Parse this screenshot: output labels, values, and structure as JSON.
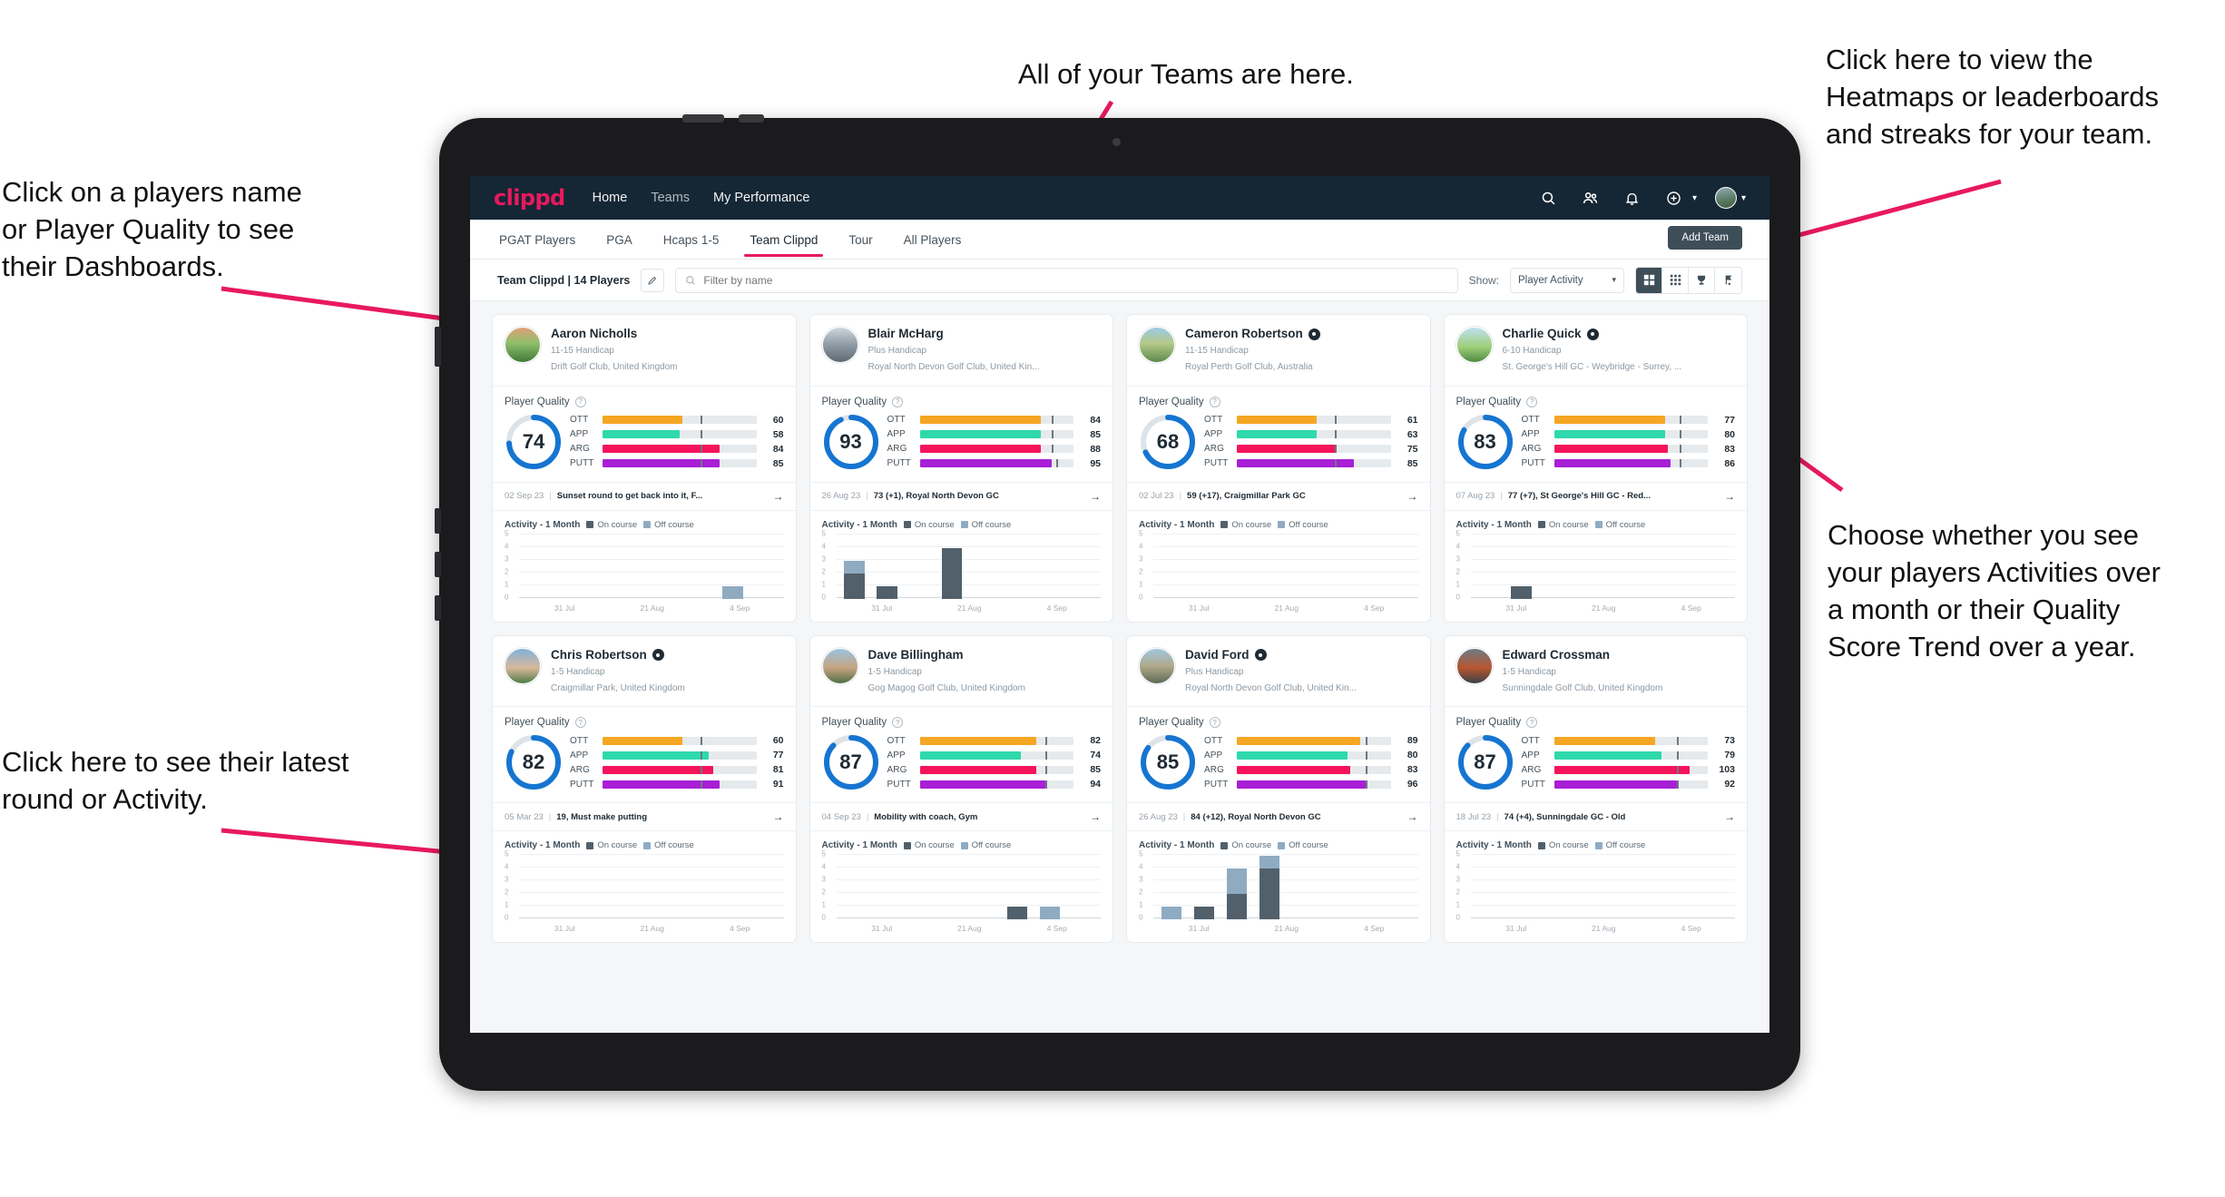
{
  "annotations": {
    "left_top": "Click on a players name\nor Player Quality to see\ntheir Dashboards.",
    "center_top": "All of your Teams are here.",
    "right_top": "Click here to view the\nHeatmaps or leaderboards\nand streaks for your team.",
    "right_mid": "Choose whether you see\nyour players Activities over\na month or their Quality\nScore Trend over a year.",
    "left_bottom": "Click here to see their latest\nround or Activity."
  },
  "accent_color": "#e8195e",
  "appbar": {
    "brand": "clippd",
    "links": [
      {
        "label": "Home",
        "active": true
      },
      {
        "label": "Teams",
        "active": false
      },
      {
        "label": "My Performance",
        "active": true
      }
    ],
    "icons": [
      "search-icon",
      "people-icon",
      "bell-icon",
      "plus-circle-icon",
      "avatar"
    ]
  },
  "tabs": [
    {
      "label": "PGAT Players",
      "active": false
    },
    {
      "label": "PGA",
      "active": false
    },
    {
      "label": "Hcaps 1-5",
      "active": false
    },
    {
      "label": "Team Clippd",
      "active": true
    },
    {
      "label": "Tour",
      "active": false
    },
    {
      "label": "All Players",
      "active": false
    }
  ],
  "add_team_label": "Add Team",
  "filterbar": {
    "team_label": "Team Clippd | 14 Players",
    "edit_icon": "pencil-icon",
    "search_placeholder": "Filter by name",
    "search_value": "",
    "show_label": "Show:",
    "show_value": "Player Activity",
    "view_toggles": [
      {
        "name": "grid-large-icon",
        "active": true
      },
      {
        "name": "grid-small-icon",
        "active": false
      },
      {
        "name": "trophy-icon",
        "active": false
      },
      {
        "name": "flag-icon",
        "active": false
      }
    ]
  },
  "metric_colors": {
    "OTT": "#f5a623",
    "APP": "#2ed9ac",
    "ARG": "#f5145b",
    "PUTT": "#a81fd6"
  },
  "activity_legend": {
    "on": "On course",
    "off": "Off course"
  },
  "activity_title": "Activity - 1 Month",
  "chart_axis": {
    "yticks": [
      5,
      4,
      3,
      2,
      1,
      0
    ],
    "xticks": [
      "31 Jul",
      "21 Aug",
      "4 Sep"
    ]
  },
  "players": [
    {
      "name": "Aaron Nicholls",
      "verified": false,
      "handicap": "11-15 Handicap",
      "club": "Drift Golf Club, United Kingdom",
      "quality_label": "Player Quality",
      "score": 74,
      "metrics": [
        {
          "key": "OTT",
          "value": 60,
          "fill": 52,
          "tick": 64
        },
        {
          "key": "APP",
          "value": 58,
          "fill": 50,
          "tick": 64
        },
        {
          "key": "ARG",
          "value": 84,
          "fill": 76,
          "tick": 64
        },
        {
          "key": "PUTT",
          "value": 85,
          "fill": 76,
          "tick": 64
        }
      ],
      "round": {
        "date": "02 Sep 23",
        "text": "Sunset round to get back into it, F..."
      },
      "chart_data": {
        "type": "bar",
        "bars": [
          {
            "on": 0,
            "off": 0
          },
          {
            "on": 0,
            "off": 0
          },
          {
            "on": 0,
            "off": 0
          },
          {
            "on": 0,
            "off": 0
          },
          {
            "on": 0,
            "off": 0
          },
          {
            "on": 0,
            "off": 0
          },
          {
            "on": 0,
            "off": 1
          },
          {
            "on": 0,
            "off": 0
          }
        ]
      }
    },
    {
      "name": "Blair McHarg",
      "verified": false,
      "handicap": "Plus Handicap",
      "club": "Royal North Devon Golf Club, United Kin...",
      "quality_label": "Player Quality",
      "score": 93,
      "metrics": [
        {
          "key": "OTT",
          "value": 84,
          "fill": 79,
          "tick": 86
        },
        {
          "key": "APP",
          "value": 85,
          "fill": 79,
          "tick": 86
        },
        {
          "key": "ARG",
          "value": 88,
          "fill": 79,
          "tick": 86
        },
        {
          "key": "PUTT",
          "value": 95,
          "fill": 86,
          "tick": 89
        }
      ],
      "round": {
        "date": "26 Aug 23",
        "text": "73 (+1), Royal North Devon GC"
      },
      "chart_data": {
        "type": "bar",
        "bars": [
          {
            "on": 2,
            "off": 1
          },
          {
            "on": 1,
            "off": 0
          },
          {
            "on": 0,
            "off": 0
          },
          {
            "on": 4,
            "off": 0
          },
          {
            "on": 0,
            "off": 0
          },
          {
            "on": 0,
            "off": 0
          },
          {
            "on": 0,
            "off": 0
          },
          {
            "on": 0,
            "off": 0
          }
        ]
      }
    },
    {
      "name": "Cameron Robertson",
      "verified": true,
      "handicap": "11-15 Handicap",
      "club": "Royal Perth Golf Club, Australia",
      "quality_label": "Player Quality",
      "score": 68,
      "metrics": [
        {
          "key": "OTT",
          "value": 61,
          "fill": 52,
          "tick": 64
        },
        {
          "key": "APP",
          "value": 63,
          "fill": 52,
          "tick": 64
        },
        {
          "key": "ARG",
          "value": 75,
          "fill": 65,
          "tick": 64
        },
        {
          "key": "PUTT",
          "value": 85,
          "fill": 76,
          "tick": 64
        }
      ],
      "round": {
        "date": "02 Jul 23",
        "text": "59 (+17), Craigmillar Park GC"
      },
      "chart_data": {
        "type": "bar",
        "bars": [
          {
            "on": 0,
            "off": 0
          },
          {
            "on": 0,
            "off": 0
          },
          {
            "on": 0,
            "off": 0
          },
          {
            "on": 0,
            "off": 0
          },
          {
            "on": 0,
            "off": 0
          },
          {
            "on": 0,
            "off": 0
          },
          {
            "on": 0,
            "off": 0
          },
          {
            "on": 0,
            "off": 0
          }
        ]
      }
    },
    {
      "name": "Charlie Quick",
      "verified": true,
      "handicap": "6-10 Handicap",
      "club": "St. George's Hill GC - Weybridge - Surrey, ...",
      "quality_label": "Player Quality",
      "score": 83,
      "metrics": [
        {
          "key": "OTT",
          "value": 77,
          "fill": 72,
          "tick": 82
        },
        {
          "key": "APP",
          "value": 80,
          "fill": 72,
          "tick": 82
        },
        {
          "key": "ARG",
          "value": 83,
          "fill": 74,
          "tick": 82
        },
        {
          "key": "PUTT",
          "value": 86,
          "fill": 76,
          "tick": 82
        }
      ],
      "round": {
        "date": "07 Aug 23",
        "text": "77 (+7), St George's Hill GC - Red..."
      },
      "chart_data": {
        "type": "bar",
        "bars": [
          {
            "on": 0,
            "off": 0
          },
          {
            "on": 1,
            "off": 0
          },
          {
            "on": 0,
            "off": 0
          },
          {
            "on": 0,
            "off": 0
          },
          {
            "on": 0,
            "off": 0
          },
          {
            "on": 0,
            "off": 0
          },
          {
            "on": 0,
            "off": 0
          },
          {
            "on": 0,
            "off": 0
          }
        ]
      }
    },
    {
      "name": "Chris Robertson",
      "verified": true,
      "handicap": "1-5 Handicap",
      "club": "Craigmillar Park, United Kingdom",
      "quality_label": "Player Quality",
      "score": 82,
      "metrics": [
        {
          "key": "OTT",
          "value": 60,
          "fill": 52,
          "tick": 64
        },
        {
          "key": "APP",
          "value": 77,
          "fill": 69,
          "tick": 64
        },
        {
          "key": "ARG",
          "value": 81,
          "fill": 72,
          "tick": 64
        },
        {
          "key": "PUTT",
          "value": 91,
          "fill": 76,
          "tick": 64
        }
      ],
      "round": {
        "date": "05 Mar 23",
        "text": "19, Must make putting"
      },
      "chart_data": {
        "type": "bar",
        "bars": [
          {
            "on": 0,
            "off": 0
          },
          {
            "on": 0,
            "off": 0
          },
          {
            "on": 0,
            "off": 0
          },
          {
            "on": 0,
            "off": 0
          },
          {
            "on": 0,
            "off": 0
          },
          {
            "on": 0,
            "off": 0
          },
          {
            "on": 0,
            "off": 0
          },
          {
            "on": 0,
            "off": 0
          }
        ]
      }
    },
    {
      "name": "Dave Billingham",
      "verified": false,
      "handicap": "1-5 Handicap",
      "club": "Gog Magog Golf Club, United Kingdom",
      "quality_label": "Player Quality",
      "score": 87,
      "metrics": [
        {
          "key": "OTT",
          "value": 82,
          "fill": 76,
          "tick": 82
        },
        {
          "key": "APP",
          "value": 74,
          "fill": 66,
          "tick": 82
        },
        {
          "key": "ARG",
          "value": 85,
          "fill": 76,
          "tick": 82
        },
        {
          "key": "PUTT",
          "value": 94,
          "fill": 82,
          "tick": 82
        }
      ],
      "round": {
        "date": "04 Sep 23",
        "text": "Mobility with coach, Gym"
      },
      "chart_data": {
        "type": "bar",
        "bars": [
          {
            "on": 0,
            "off": 0
          },
          {
            "on": 0,
            "off": 0
          },
          {
            "on": 0,
            "off": 0
          },
          {
            "on": 0,
            "off": 0
          },
          {
            "on": 0,
            "off": 0
          },
          {
            "on": 1,
            "off": 0
          },
          {
            "on": 0,
            "off": 1
          },
          {
            "on": 0,
            "off": 0
          }
        ]
      }
    },
    {
      "name": "David Ford",
      "verified": true,
      "handicap": "Plus Handicap",
      "club": "Royal North Devon Golf Club, United Kin...",
      "quality_label": "Player Quality",
      "score": 85,
      "metrics": [
        {
          "key": "OTT",
          "value": 89,
          "fill": 80,
          "tick": 84
        },
        {
          "key": "APP",
          "value": 80,
          "fill": 72,
          "tick": 84
        },
        {
          "key": "ARG",
          "value": 83,
          "fill": 74,
          "tick": 84
        },
        {
          "key": "PUTT",
          "value": 96,
          "fill": 84,
          "tick": 84
        }
      ],
      "round": {
        "date": "26 Aug 23",
        "text": "84 (+12), Royal North Devon GC"
      },
      "chart_data": {
        "type": "bar",
        "bars": [
          {
            "on": 0,
            "off": 1
          },
          {
            "on": 1,
            "off": 0
          },
          {
            "on": 2,
            "off": 2
          },
          {
            "on": 4,
            "off": 1
          },
          {
            "on": 0,
            "off": 0
          },
          {
            "on": 0,
            "off": 0
          },
          {
            "on": 0,
            "off": 0
          },
          {
            "on": 0,
            "off": 0
          }
        ]
      }
    },
    {
      "name": "Edward Crossman",
      "verified": false,
      "handicap": "1-5 Handicap",
      "club": "Sunningdale Golf Club, United Kingdom",
      "quality_label": "Player Quality",
      "score": 87,
      "metrics": [
        {
          "key": "OTT",
          "value": 73,
          "fill": 66,
          "tick": 80
        },
        {
          "key": "APP",
          "value": 79,
          "fill": 70,
          "tick": 80
        },
        {
          "key": "ARG",
          "value": 103,
          "fill": 88,
          "tick": 80
        },
        {
          "key": "PUTT",
          "value": 92,
          "fill": 80,
          "tick": 80
        }
      ],
      "round": {
        "date": "18 Jul 23",
        "text": "74 (+4), Sunningdale GC - Old"
      },
      "chart_data": {
        "type": "bar",
        "bars": [
          {
            "on": 0,
            "off": 0
          },
          {
            "on": 0,
            "off": 0
          },
          {
            "on": 0,
            "off": 0
          },
          {
            "on": 0,
            "off": 0
          },
          {
            "on": 0,
            "off": 0
          },
          {
            "on": 0,
            "off": 0
          },
          {
            "on": 0,
            "off": 0
          },
          {
            "on": 0,
            "off": 0
          }
        ]
      }
    }
  ]
}
